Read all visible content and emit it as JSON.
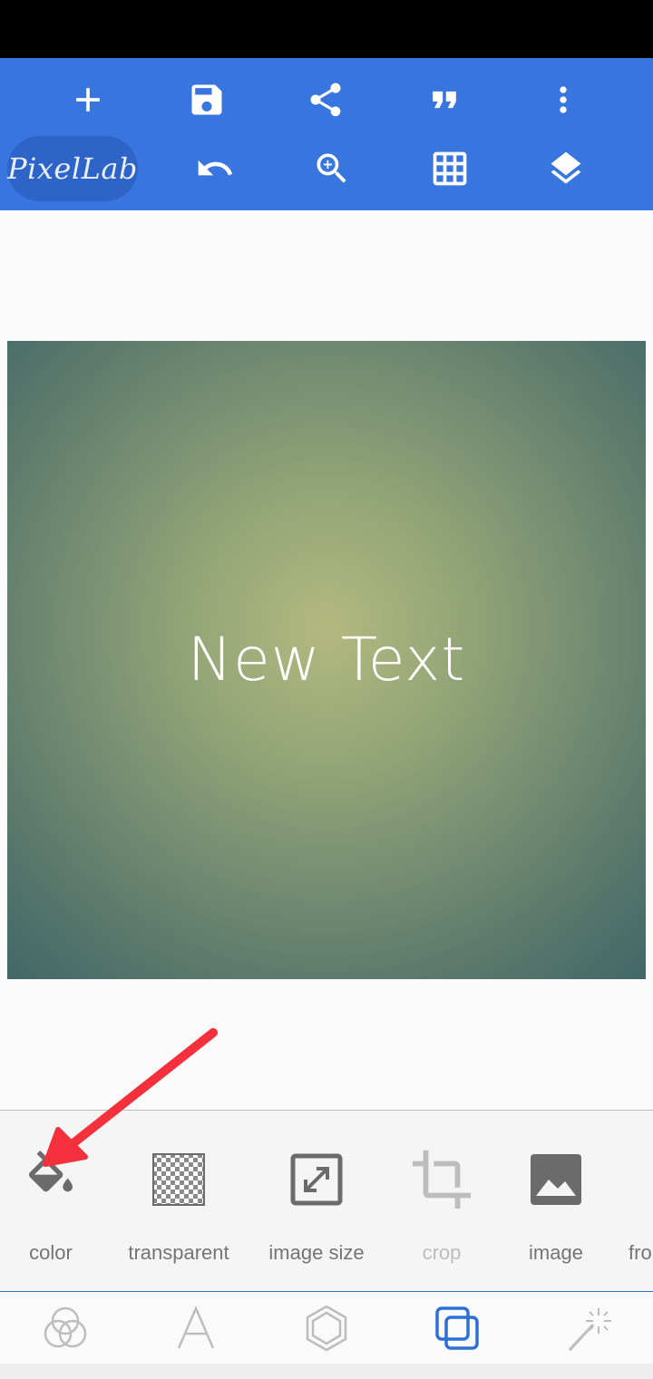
{
  "app": {
    "logo": "PixelLab"
  },
  "toolbar": {
    "top_row": [
      "plus-icon",
      "save-icon",
      "share-icon",
      "quote-icon",
      "more-vert-icon"
    ],
    "bottom_row": [
      "undo-icon",
      "zoom-in-icon",
      "grid-icon",
      "layers-icon"
    ]
  },
  "canvas": {
    "text": "New Text",
    "gradient_center": "#b3b97f",
    "gradient_edge": "#426766"
  },
  "tools": [
    {
      "label": "color",
      "icon": "paint-bucket-icon"
    },
    {
      "label": "transparent",
      "icon": "checkerboard-icon"
    },
    {
      "label": "image size",
      "icon": "resize-icon"
    },
    {
      "label": "crop",
      "icon": "crop-icon",
      "disabled": true
    },
    {
      "label": "image",
      "icon": "image-icon"
    },
    {
      "label": "fro",
      "icon": "from-icon"
    }
  ],
  "tabs": [
    {
      "name": "effects",
      "icon": "color-circles-icon"
    },
    {
      "name": "text",
      "icon": "text-a-icon"
    },
    {
      "name": "shapes",
      "icon": "hexagon-icon"
    },
    {
      "name": "background",
      "icon": "layers-square-icon",
      "active": true
    },
    {
      "name": "magic",
      "icon": "magic-wand-icon"
    }
  ],
  "colors": {
    "accent": "#3875de",
    "arrow": "#f3303c"
  }
}
